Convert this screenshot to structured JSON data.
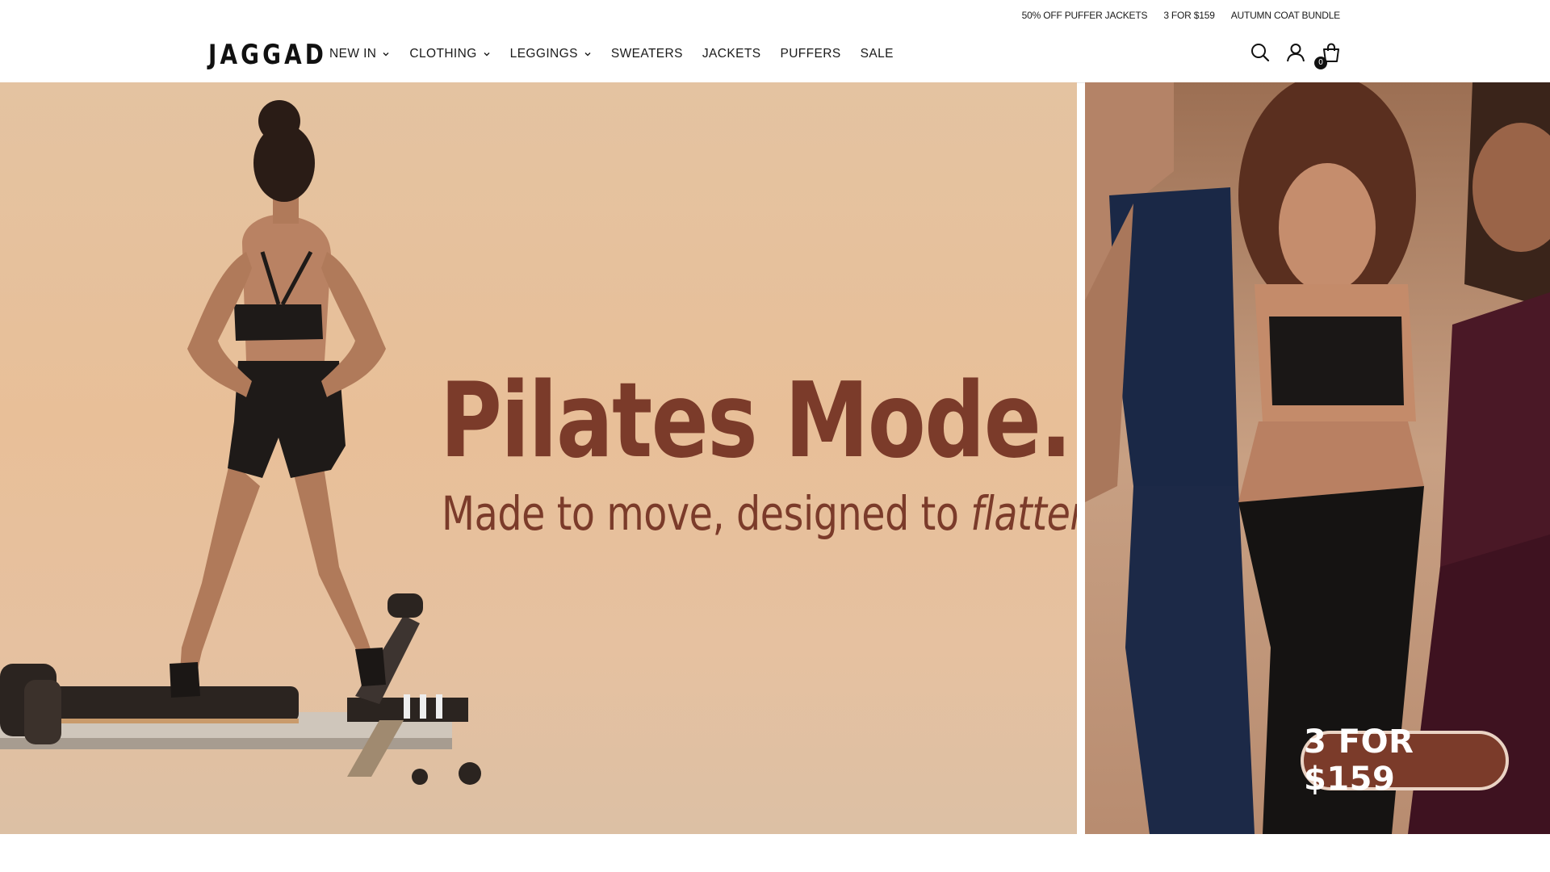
{
  "announcement": {
    "links": [
      "50% OFF PUFFER JACKETS",
      "3 FOR $159",
      "AUTUMN COAT BUNDLE"
    ]
  },
  "header": {
    "logo": "JAGGAD",
    "nav": [
      {
        "label": "NEW IN",
        "has_dropdown": true
      },
      {
        "label": "CLOTHING",
        "has_dropdown": true
      },
      {
        "label": "LEGGINGS",
        "has_dropdown": true
      },
      {
        "label": "SWEATERS",
        "has_dropdown": false
      },
      {
        "label": "JACKETS",
        "has_dropdown": false
      },
      {
        "label": "PUFFERS",
        "has_dropdown": false
      },
      {
        "label": "SALE",
        "has_dropdown": false
      }
    ],
    "icons": [
      "search-icon",
      "account-icon",
      "cart-icon"
    ],
    "cart_count": "0"
  },
  "hero": {
    "title": "Pilates Mode.",
    "subtitle": "Made to move, designed to",
    "subtitle_emphasis": "flatter.",
    "promo": "3 FOR $159"
  },
  "colors": {
    "brand_text": "#7b3b2a",
    "hero_bg": "#e8bf98",
    "pill_bg": "#7b3b2a",
    "pill_border": "#ead3c4"
  }
}
